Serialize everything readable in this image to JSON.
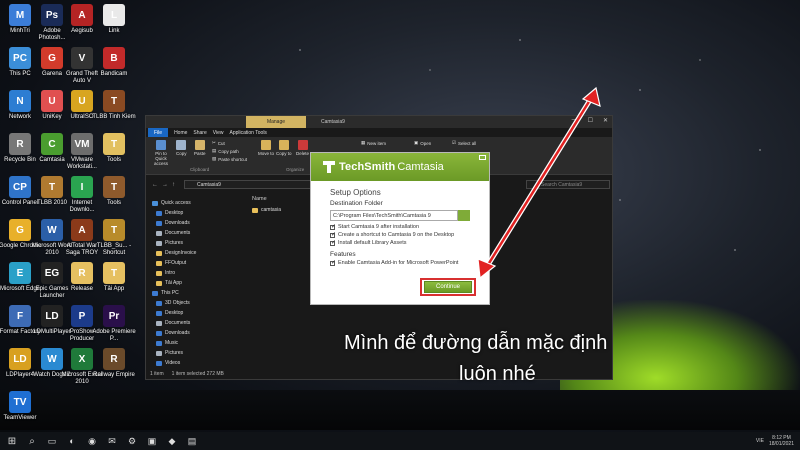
{
  "desktop": {
    "icons": [
      {
        "label": "MinhTri",
        "color": "#3b7dd8",
        "glyph": "M"
      },
      {
        "label": "Adobe Photosh...",
        "color": "#1a2b57",
        "glyph": "Ps"
      },
      {
        "label": "Aegisub",
        "color": "#b52424",
        "glyph": "A"
      },
      {
        "label": "Link",
        "color": "#e9e9e9",
        "glyph": "L"
      },
      {
        "label": "This PC",
        "color": "#3b8ed8",
        "glyph": "PC"
      },
      {
        "label": "Garena",
        "color": "#d23b2b",
        "glyph": "G"
      },
      {
        "label": "Grand Theft Auto V",
        "color": "#333333",
        "glyph": "V"
      },
      {
        "label": "Bandicam",
        "color": "#c22a2a",
        "glyph": "B"
      },
      {
        "label": "Network",
        "color": "#2d7dd2",
        "glyph": "N"
      },
      {
        "label": "UniKey",
        "color": "#e05050",
        "glyph": "U"
      },
      {
        "label": "UltraISO",
        "color": "#d8a520",
        "glyph": "U"
      },
      {
        "label": "TLBB Tinh Kiem",
        "color": "#8a4a22",
        "glyph": "T"
      },
      {
        "label": "Recycle Bin",
        "color": "#777777",
        "glyph": "R"
      },
      {
        "label": "Camtasia",
        "color": "#4a9d2f",
        "glyph": "C"
      },
      {
        "label": "VMware Workstati...",
        "color": "#6d6d6d",
        "glyph": "VM"
      },
      {
        "label": "Tools",
        "color": "#e2c060",
        "glyph": "T"
      },
      {
        "label": "Control Panel",
        "color": "#2f74c9",
        "glyph": "CP"
      },
      {
        "label": "TLBB 2010",
        "color": "#b07a30",
        "glyph": "T"
      },
      {
        "label": "Internet Downlo...",
        "color": "#2aa450",
        "glyph": "I"
      },
      {
        "label": "Tools",
        "color": "#8f5a2c",
        "glyph": "T"
      },
      {
        "label": "Google Chrome",
        "color": "#e8b02a",
        "glyph": "G"
      },
      {
        "label": "Microsoft Word 2010",
        "color": "#2b5fa8",
        "glyph": "W"
      },
      {
        "label": "A Total War Saga TROY",
        "color": "#8b3a1a",
        "glyph": "A"
      },
      {
        "label": "TLBB_Su... - Shortcut",
        "color": "#b88b2a",
        "glyph": "T"
      },
      {
        "label": "Microsoft Edge",
        "color": "#2aa0c8",
        "glyph": "E"
      },
      {
        "label": "Epic Games Launcher",
        "color": "#222222",
        "glyph": "EG"
      },
      {
        "label": "Release",
        "color": "#e6c061",
        "glyph": "R"
      },
      {
        "label": "Tải App",
        "color": "#e6c061",
        "glyph": "T"
      },
      {
        "label": "Format Factory",
        "color": "#3d6bb5",
        "glyph": "F"
      },
      {
        "label": "LDMultiPlayer",
        "color": "#222222",
        "glyph": "LD"
      },
      {
        "label": "ProShow Producer",
        "color": "#1c3b8a",
        "glyph": "P"
      },
      {
        "label": "Adobe Premiere P...",
        "color": "#2a0f4a",
        "glyph": "Pr"
      },
      {
        "label": "LDPlayer4",
        "color": "#d8a020",
        "glyph": "LD"
      },
      {
        "label": "Watch Dogs 2",
        "color": "#2a8ad2",
        "glyph": "W"
      },
      {
        "label": "Microsoft Excel 2010",
        "color": "#1f7a3a",
        "glyph": "X"
      },
      {
        "label": "Railway Empire",
        "color": "#6a4a2a",
        "glyph": "R"
      },
      {
        "label": "TeamViewer",
        "color": "#1f6fd2",
        "glyph": "TV"
      }
    ]
  },
  "explorer": {
    "tab_manage": "Manage",
    "title": "Camtasia9",
    "win_min": "—",
    "win_max": "☐",
    "win_close": "✕",
    "ribbon_tabs": [
      "File",
      "Home",
      "Share",
      "View",
      "Application Tools"
    ],
    "ribbon": {
      "pin": "Pin to Quick access",
      "copy": "Copy",
      "paste": "Paste",
      "cut": "Cut",
      "copy_path": "Copy path",
      "paste_shortcut": "Paste shortcut",
      "move_to": "Move to",
      "copy_to": "Copy to",
      "delete": "Delete",
      "new_item": "New item",
      "open": "Open",
      "select_all": "Select all",
      "group_clipboard": "Clipboard",
      "group_organize": "Organize"
    },
    "address": "Camtasia9",
    "search_placeholder": "Search Camtasia9",
    "nav_pane": [
      {
        "label": "Quick access",
        "color": "#4a90d9"
      },
      {
        "label": "Desktop",
        "color": "#3d7bd1"
      },
      {
        "label": "Downloads",
        "color": "#3d7bd1"
      },
      {
        "label": "Documents",
        "color": "#aab4c0"
      },
      {
        "label": "Pictures",
        "color": "#aab4c0"
      },
      {
        "label": "DesignInvoice",
        "color": "#e8c05a"
      },
      {
        "label": "FFOutput",
        "color": "#e8c05a"
      },
      {
        "label": "Intro",
        "color": "#e8c05a"
      },
      {
        "label": "Tải App",
        "color": "#e8c05a"
      },
      {
        "label": "This PC",
        "color": "#3d7bd1"
      },
      {
        "label": "3D Objects",
        "color": "#3d7bd1"
      },
      {
        "label": "Desktop",
        "color": "#3d7bd1"
      },
      {
        "label": "Documents",
        "color": "#aab4c0"
      },
      {
        "label": "Downloads",
        "color": "#3d7bd1"
      },
      {
        "label": "Music",
        "color": "#3d7bd1"
      },
      {
        "label": "Pictures",
        "color": "#aab4c0"
      },
      {
        "label": "Videos",
        "color": "#3d7bd1"
      }
    ],
    "column_name": "Name",
    "files": [
      {
        "name": "camtasia"
      }
    ],
    "status": {
      "items": "1 item",
      "selected": "1 item selected  272 MB"
    }
  },
  "dialog": {
    "brand": "TechSmith",
    "product": "Camtasia",
    "title": "Setup Options",
    "dest_label": "Destination Folder",
    "dest_path": "C:\\Program Files\\TechSmith\\Camtasia 9",
    "options": [
      "Start Camtasia 9 after installation",
      "Create a shortcut to Camtasia 9 on the Desktop",
      "Install default Library Assets"
    ],
    "features_label": "Features",
    "features": [
      "Enable Camtasia Add-in for Microsoft PowerPoint"
    ],
    "continue_label": "Continue",
    "accent": "#7fab38"
  },
  "caption": {
    "line1": "Mình để đường dẫn mặc định",
    "line2": "luôn nhé"
  },
  "taskbar": {
    "start": "⊞",
    "search": "⌕",
    "items": [
      "▭",
      "◐",
      "◉",
      "✉",
      "⚙",
      "▣",
      "◆",
      "▤"
    ],
    "tray_lang": "VIE",
    "time": "8:12 PM",
    "date": "18/01/2021"
  },
  "annotation_color": "#e22222"
}
